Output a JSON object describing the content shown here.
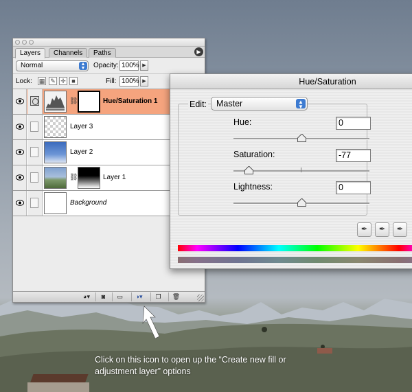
{
  "layers_panel": {
    "tabs": [
      {
        "label": "Layers",
        "active": true
      },
      {
        "label": "Channels",
        "active": false
      },
      {
        "label": "Paths",
        "active": false
      }
    ],
    "blend_mode": "Normal",
    "opacity_label": "Opacity:",
    "opacity_value": "100%",
    "lock_label": "Lock:",
    "fill_label": "Fill:",
    "fill_value": "100%",
    "layers": [
      {
        "name": "Hue/Saturation 1",
        "selected": true,
        "type": "adjustment",
        "has_mask": true
      },
      {
        "name": "Layer 3",
        "selected": false,
        "type": "pixel"
      },
      {
        "name": "Layer 2",
        "selected": false,
        "type": "pixel"
      },
      {
        "name": "Layer 1",
        "selected": false,
        "type": "pixel",
        "has_mask": true
      },
      {
        "name": "Background",
        "selected": false,
        "type": "background"
      }
    ],
    "bottom_buttons": [
      "layer-style-icon",
      "add-mask-icon",
      "new-group-icon",
      "new-adjustment-layer-icon",
      "new-layer-icon",
      "trash-icon"
    ]
  },
  "hue_saturation": {
    "title": "Hue/Saturation",
    "edit_label": "Edit:",
    "edit_value": "Master",
    "hue_label": "Hue:",
    "hue_value": "0",
    "saturation_label": "Saturation:",
    "saturation_value": "-77",
    "lightness_label": "Lightness:",
    "lightness_value": "0",
    "tools": [
      "eyedropper-icon",
      "eyedropper-plus-icon",
      "eyedropper-minus-icon"
    ]
  },
  "caption": "Click on this icon to open up the “Create new fill or adjustment layer” options",
  "colors": {
    "selected_layer": "#f5a47e",
    "accent": "#3d7bd1"
  }
}
